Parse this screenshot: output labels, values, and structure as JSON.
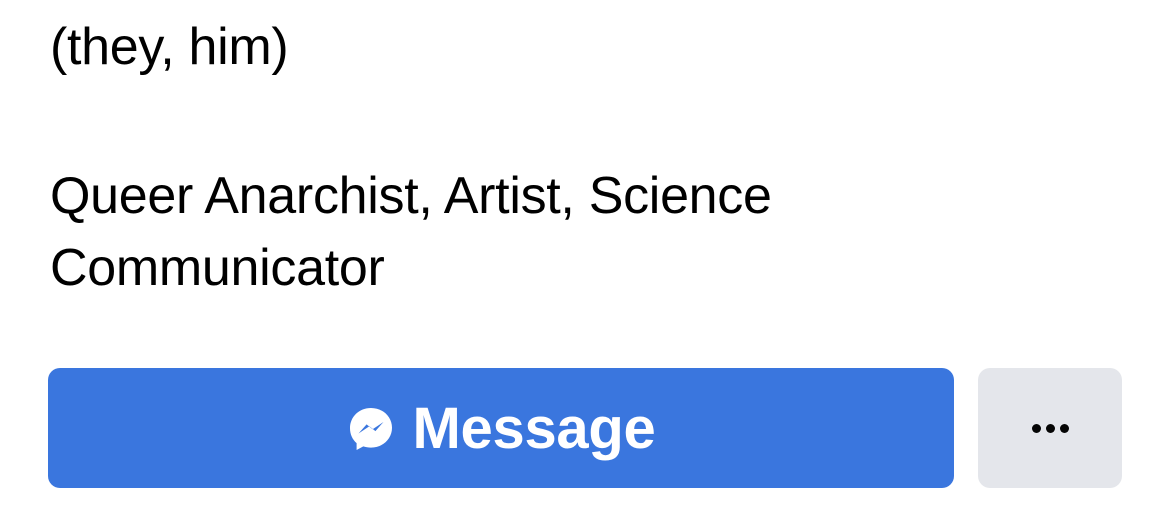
{
  "profile": {
    "pronouns": "(they, him)",
    "bio_line_1": "Queer Anarchist, Artist, Science",
    "bio_line_2": "Communicator"
  },
  "actions": {
    "message_label": "Message",
    "message_icon": "messenger-icon",
    "more_icon": "more-options-icon"
  },
  "colors": {
    "primary": "#3a76de",
    "secondary_bg": "#e4e6eb"
  }
}
